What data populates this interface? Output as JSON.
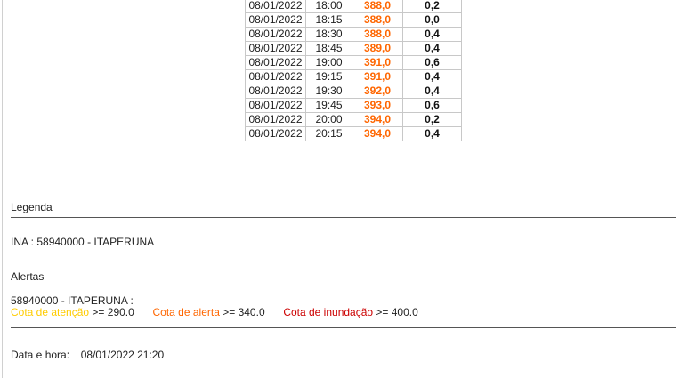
{
  "readings": [
    {
      "date": "08/01/2022",
      "time": "18:00",
      "level": "388,0",
      "rain": "0,2"
    },
    {
      "date": "08/01/2022",
      "time": "18:15",
      "level": "388,0",
      "rain": "0,0"
    },
    {
      "date": "08/01/2022",
      "time": "18:30",
      "level": "388,0",
      "rain": "0,4"
    },
    {
      "date": "08/01/2022",
      "time": "18:45",
      "level": "389,0",
      "rain": "0,4"
    },
    {
      "date": "08/01/2022",
      "time": "19:00",
      "level": "391,0",
      "rain": "0,6"
    },
    {
      "date": "08/01/2022",
      "time": "19:15",
      "level": "391,0",
      "rain": "0,4"
    },
    {
      "date": "08/01/2022",
      "time": "19:30",
      "level": "392,0",
      "rain": "0,4"
    },
    {
      "date": "08/01/2022",
      "time": "19:45",
      "level": "393,0",
      "rain": "0,6"
    },
    {
      "date": "08/01/2022",
      "time": "20:00",
      "level": "394,0",
      "rain": "0,2"
    },
    {
      "date": "08/01/2022",
      "time": "20:15",
      "level": "394,0",
      "rain": "0,4"
    }
  ],
  "legend": {
    "title": "Legenda",
    "station": "INA : 58940000 - ITAPERUNA"
  },
  "alerts": {
    "title": "Alertas",
    "station": "58940000 - ITAPERUNA :",
    "attention_label": "Cota de atenção",
    "attention_value": ">= 290.0",
    "alert_label": "Cota de alerta",
    "alert_value": ">= 340.0",
    "flood_label": "Cota de inundação",
    "flood_value": ">= 400.0"
  },
  "datetime": {
    "label": "Data e hora:",
    "value": "08/01/2022 21:20"
  },
  "colors": {
    "attention": "#ffcc00",
    "alert": "#ff6600",
    "flood": "#cc0000",
    "level_text": "#ff6600"
  }
}
